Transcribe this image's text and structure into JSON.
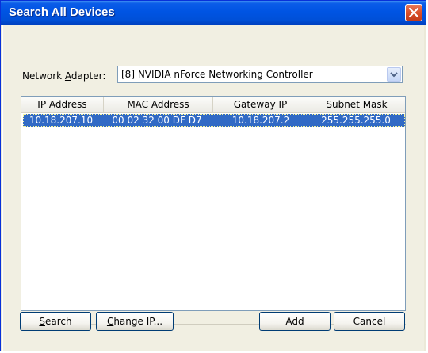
{
  "window": {
    "title": "Search All Devices"
  },
  "adapter": {
    "label_mnemonic_pre": "Network ",
    "label_mnemonic_char": "A",
    "label_mnemonic_post": "dapter:",
    "selected": "[8] NVIDIA nForce Networking Controller"
  },
  "table": {
    "columns": [
      "IP Address",
      "MAC Address",
      "Gateway IP",
      "Subnet Mask"
    ],
    "rows": [
      [
        "10.18.207.10",
        "00 02 32 00 DF D7",
        "10.18.207.2",
        "255.255.255.0"
      ]
    ]
  },
  "buttons": {
    "search_pre": "",
    "search_char": "S",
    "search_post": "earch",
    "change_pre": "",
    "change_char": "C",
    "change_post": "hange IP...",
    "add": "Add",
    "cancel": "Cancel"
  },
  "colors": {
    "titlebar": "#0054e3",
    "selection": "#316ac5",
    "dialog_bg": "#ece9d8"
  }
}
